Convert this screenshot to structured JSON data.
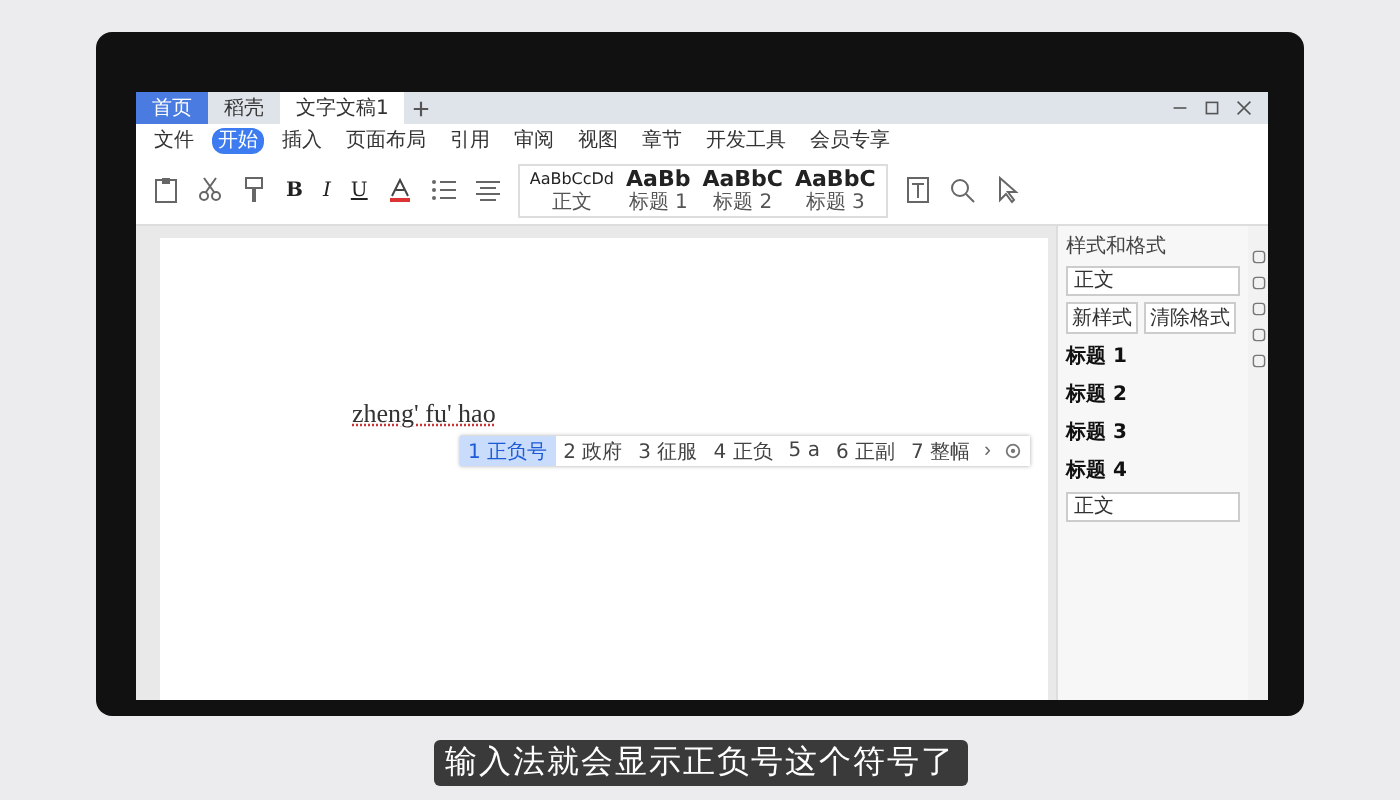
{
  "tabs": [
    {
      "label": "首页",
      "selected": false
    },
    {
      "label": "稻壳",
      "selected": false
    },
    {
      "label": "文字文稿1",
      "selected": true
    }
  ],
  "menu": [
    {
      "label": "文件",
      "selected": false
    },
    {
      "label": "开始",
      "selected": true
    },
    {
      "label": "插入",
      "selected": false
    },
    {
      "label": "页面布局",
      "selected": false
    },
    {
      "label": "引用",
      "selected": false
    },
    {
      "label": "审阅",
      "selected": false
    },
    {
      "label": "视图",
      "selected": false
    },
    {
      "label": "章节",
      "selected": false
    },
    {
      "label": "开发工具",
      "selected": false
    },
    {
      "label": "会员专享",
      "selected": false
    }
  ],
  "format_buttons": [
    "B",
    "I",
    "U"
  ],
  "style_gallery": [
    {
      "sample": "AaBbCcDd",
      "label": "正文"
    },
    {
      "sample": "AaBb",
      "label": "标题 1"
    },
    {
      "sample": "AaBbC",
      "label": "标题 2"
    },
    {
      "sample": "AaBbC",
      "label": "标题 3"
    }
  ],
  "document": {
    "typed_text": "zheng' fu' hao"
  },
  "candidates": [
    {
      "index": "1",
      "word": "正负号",
      "selected": true
    },
    {
      "index": "2",
      "word": "政府",
      "selected": false
    },
    {
      "index": "3",
      "word": "征服",
      "selected": false
    },
    {
      "index": "4",
      "word": "正负",
      "selected": false
    },
    {
      "index": "5",
      "word": "a",
      "selected": false
    },
    {
      "index": "6",
      "word": "正副",
      "selected": false
    },
    {
      "index": "7",
      "word": "整幅",
      "selected": false
    }
  ],
  "candidate_next": "›",
  "styles_pane": {
    "title": "样式和格式",
    "current_style": "正文",
    "buttons": [
      "新样式",
      "清除格式"
    ],
    "styles": [
      "标题 1",
      "标题 2",
      "标题 3",
      "标题 4"
    ],
    "apply_field": "正文"
  },
  "subtitle": "输入法就会显示正负号这个符号了"
}
